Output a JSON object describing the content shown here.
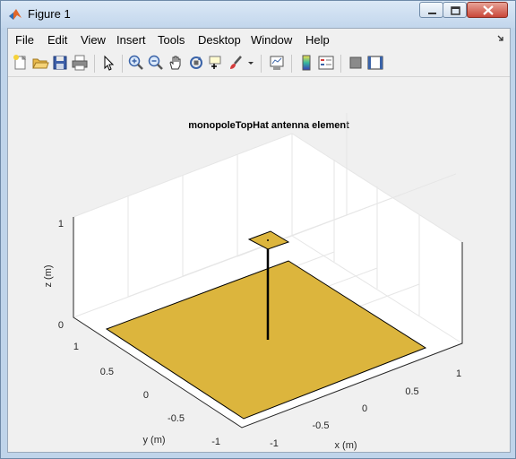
{
  "window": {
    "title": "Figure 1"
  },
  "menubar": {
    "items": [
      "File",
      "Edit",
      "View",
      "Insert",
      "Tools",
      "Desktop",
      "Window",
      "Help"
    ]
  },
  "toolbar": {
    "icons": [
      "new-figure-icon",
      "open-file-icon",
      "save-icon",
      "print-icon",
      "pointer-icon",
      "zoom-in-icon",
      "zoom-out-icon",
      "pan-icon",
      "rotate-3d-icon",
      "data-cursor-icon",
      "brush-icon",
      "link-plot-icon",
      "colorbar-icon",
      "legend-icon",
      "hide-plot-tools-icon",
      "show-plot-tools-icon"
    ]
  },
  "colors": {
    "ground_plane": "#dcb53d",
    "top_hat": "#dcb53d",
    "feed": "#000000",
    "grid": "#e6e6e6",
    "axes_box": "#262626"
  },
  "plot": {
    "title": "monopoleTopHat antenna element",
    "xlabel": "x (m)",
    "ylabel": "y (m)",
    "zlabel": "z (m)",
    "x_ticks": [
      "-1",
      "-0.5",
      "0",
      "0.5",
      "1"
    ],
    "y_ticks": [
      "-1",
      "-0.5",
      "0",
      "0.5",
      "1"
    ],
    "z_ticks": [
      "0",
      "1"
    ]
  }
}
